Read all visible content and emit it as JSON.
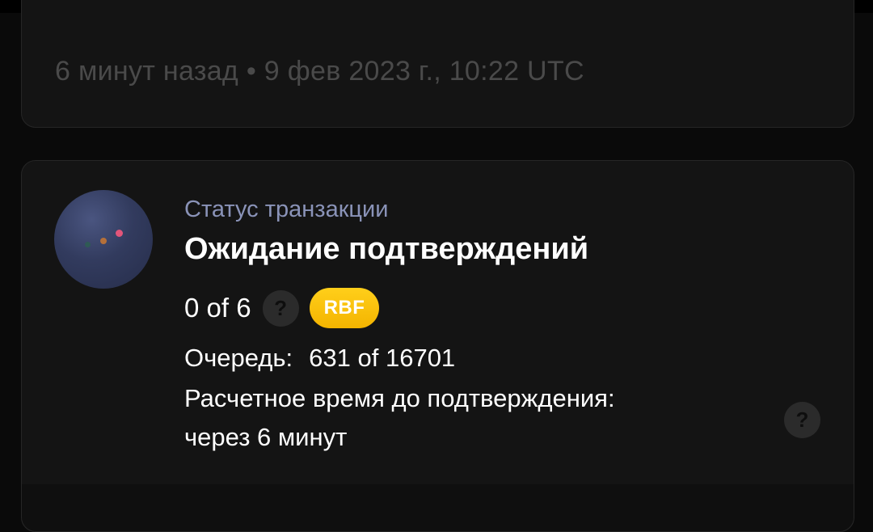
{
  "timestamp": {
    "relative": "6 минут назад",
    "separator": "•",
    "absolute": "9 фев 2023 г., 10:22 UTC"
  },
  "status": {
    "label": "Статус транзакции",
    "title": "Ожидание подтверждений",
    "confirmations": "0 of 6",
    "help_icon": "?",
    "badge": "RBF",
    "queue_label": "Очередь:",
    "queue_value": "631 of 16701",
    "eta_label": "Расчетное время до подтверждения:",
    "eta_value": "через 6 минут"
  },
  "colors": {
    "background": "#0a0a0a",
    "card": "#141414",
    "accent_label": "#8a93b8",
    "badge": "#ffc107",
    "muted_text": "#4a4a4a"
  },
  "avatar": {
    "icon": "transaction-avatar-icon",
    "dot_colors": [
      "#e2557a",
      "#b5703a",
      "#2f5a55"
    ]
  }
}
